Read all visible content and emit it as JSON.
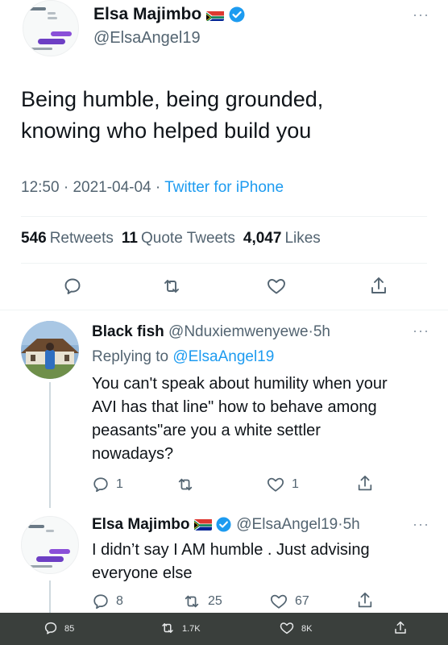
{
  "main_tweet": {
    "author_name": "Elsa Majimbo",
    "author_handle": "@ElsaAngel19",
    "text_line1": "Being humble, being grounded,",
    "text_line2": "knowing who helped build you",
    "time": "12:50",
    "sep1": "·",
    "date": "2021-04-04",
    "sep2": "·",
    "source": "Twitter for iPhone",
    "stats": {
      "retweets_count": "546",
      "retweets_label": "Retweets",
      "quotes_count": "11",
      "quotes_label": "Quote Tweets",
      "likes_count": "4,047",
      "likes_label": "Likes"
    }
  },
  "reply1": {
    "author_name": "Black fish",
    "author_handle": "@Nduxiemwenyewe",
    "sep": "·",
    "time": "5h",
    "replying_label": "Replying to",
    "replying_handle": "@ElsaAngel19",
    "lines": [
      "You can't speak about humility when your",
      "AVI has that line\" how to behave among",
      "peasants\"are you a white settler",
      "nowadays?"
    ],
    "reply_count": "1",
    "like_count": "1"
  },
  "reply2": {
    "author_name": "Elsa Majimbo",
    "author_handle": "@ElsaAngel19",
    "sep": "·",
    "time": "5h",
    "lines": [
      "I didn’t say I AM humble . Just advising",
      "everyone else"
    ],
    "reply_count": "8",
    "retweet_count": "25",
    "like_count": "67"
  },
  "bottom_bar": {
    "reply_count": "85",
    "retweet_count": "1.7K",
    "like_count": "8K"
  },
  "colors": {
    "accent": "#1d9bf0",
    "secondary_text": "#536471",
    "primary_text": "#0f1419",
    "bottom_bar": "#3a3f3c"
  },
  "icons": [
    "reply-icon",
    "retweet-icon",
    "like-icon",
    "share-icon",
    "verified-icon",
    "south-africa-flag-icon",
    "more-icon"
  ]
}
